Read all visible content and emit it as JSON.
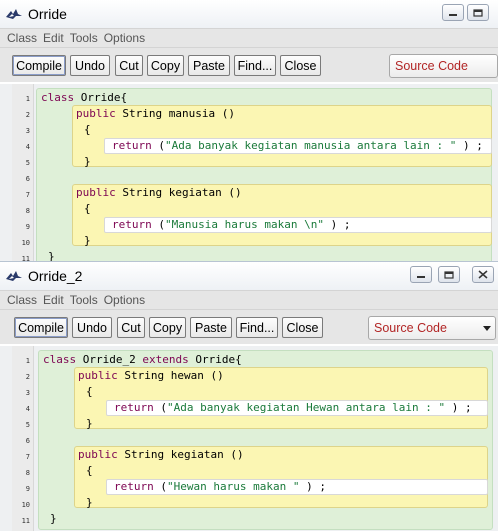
{
  "windows": [
    {
      "title": "Orride",
      "menu": [
        "Class",
        "Edit",
        "Tools",
        "Options"
      ],
      "buttons": [
        "Compile",
        "Undo",
        "Cut",
        "Copy",
        "Paste",
        "Find...",
        "Close"
      ],
      "view_selector": "Source Code",
      "line_numbers": [
        "1",
        "2",
        "3",
        "4",
        "5",
        "6",
        "7",
        "8",
        "9",
        "10",
        "11"
      ],
      "code": {
        "l1": {
          "kw": "class",
          "rest": " Orride{"
        },
        "l2": {
          "kw": "public",
          "rest": " String manusia ()"
        },
        "l3": "{",
        "l4": {
          "kw": "return",
          "pre": " (",
          "str": "\"Ada banyak kegiatan manusia antara lain : \"",
          "post": " ) ;"
        },
        "l5": "}",
        "l7": {
          "kw": "public",
          "rest": " String kegiatan ()"
        },
        "l8": "{",
        "l9": {
          "kw": "return",
          "pre": " (",
          "str": "\"Manusia harus makan \\n\"",
          "post": " ) ;"
        },
        "l10": "}",
        "l11": "}"
      }
    },
    {
      "title": "Orride_2",
      "menu": [
        "Class",
        "Edit",
        "Tools",
        "Options"
      ],
      "buttons": [
        "Compile",
        "Undo",
        "Cut",
        "Copy",
        "Paste",
        "Find...",
        "Close"
      ],
      "view_selector": "Source Code",
      "line_numbers": [
        "1",
        "2",
        "3",
        "4",
        "5",
        "6",
        "7",
        "8",
        "9",
        "10",
        "11"
      ],
      "code": {
        "l1": {
          "kw": "class",
          "mid": " Orride_2 ",
          "kw2": "extends",
          "rest": " Orride{"
        },
        "l2": {
          "kw": "public",
          "rest": " String hewan ()"
        },
        "l3": "{",
        "l4": {
          "kw": "return",
          "pre": " (",
          "str": "\"Ada banyak kegiatan Hewan antara lain : \"",
          "post": " ) ;"
        },
        "l5": "}",
        "l7": {
          "kw": "public",
          "rest": " String kegiatan ()"
        },
        "l8": "{",
        "l9": {
          "kw": "return",
          "pre": " (",
          "str": "\"Hewan harus makan \"",
          "post": " ) ;"
        },
        "l10": "}",
        "l11": "}"
      }
    }
  ],
  "colors": {
    "keyword": "#7d0552",
    "string": "#1a7a3a",
    "class_scope": "#dff0d8",
    "method_scope": "#fbf6b3",
    "view_selector_text": "#b22626"
  },
  "icons": [
    "bluej-bird-icon",
    "minimize-icon",
    "maximize-icon",
    "close-icon"
  ]
}
